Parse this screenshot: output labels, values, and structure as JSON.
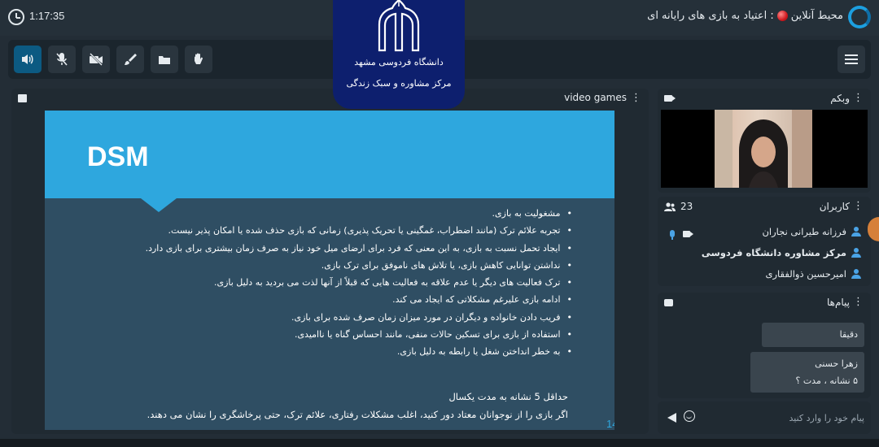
{
  "header": {
    "timer": "1:17:35",
    "env_label": "محیط آنلاین",
    "room_title": ": اعتیاد به بازی های رایانه ای"
  },
  "badge": {
    "line1": "دانشگاه فردوسی مشهد",
    "line2": "مرکز مشاوره و سبک زندگی"
  },
  "toolbar": {
    "buttons": [
      "speaker-icon",
      "mic-off-icon",
      "camera-off-icon",
      "brush-icon",
      "folder-icon",
      "raise-hand-icon"
    ],
    "menu": "hamburger-menu-icon"
  },
  "presentation": {
    "panel_title": "video games",
    "slide_title": "DSM",
    "bullets": [
      "مشغولیت به بازی.",
      "تجربه علائم ترک (مانند اضطراب، غمگینی یا تحریک پذیری) زمانی که بازی حذف شده یا امکان پذیر نیست.",
      "ایجاد تحمل نسبت به بازی، به این معنی که فرد برای ارضای میل خود نیاز به صرف زمان بیشتری برای بازی دارد.",
      "نداشتن توانایی کاهش بازی، یا تلاش های ناموفق برای ترک بازی.",
      "ترک فعالیت های دیگر یا عدم علاقه به فعالیت هایی که قبلاً از آنها لذت می بردید به دلیل بازی.",
      "ادامه بازی علیرغم مشکلاتی که ایجاد می کند.",
      "فریب دادن خانواده و دیگران در مورد میزان زمان صرف شده برای بازی.",
      "استفاده از بازی برای تسکین حالات منفی، مانند احساس گناه یا ناامیدی.",
      "به خطر انداختن شغل یا رابطه به دلیل بازی."
    ],
    "footer_line1": "حداقل 5 نشانه به مدت یکسال",
    "footer_line2": "اگر بازی را از نوجوانان معتاد دور کنید، اغلب مشکلات رفتاری، علائم ترک، حتی پرخاشگری را نشان می دهند.",
    "page_number": "14"
  },
  "webcam": {
    "title": "وبکم"
  },
  "users": {
    "title": "کاربران",
    "count": "23",
    "list": [
      {
        "name": "فرزانه طیرانی نجاران"
      },
      {
        "name": "مرکز مشاوره دانشگاه فردوسی"
      },
      {
        "name": "امیرحسین ذوالفقاری"
      }
    ]
  },
  "chat": {
    "title": "پیام‌ها",
    "messages": [
      {
        "text": "دقیقا"
      },
      {
        "author": "زهرا حسنی",
        "text": "۵ نشانه ، مدت ؟"
      }
    ],
    "input_placeholder": "پیام خود را وارد کنید"
  },
  "colors": {
    "background": "#232d36",
    "accent": "#2ea7de",
    "slide_body": "#2f4e63",
    "badge": "#0d1f6e",
    "live_dot": "#d0191f"
  }
}
